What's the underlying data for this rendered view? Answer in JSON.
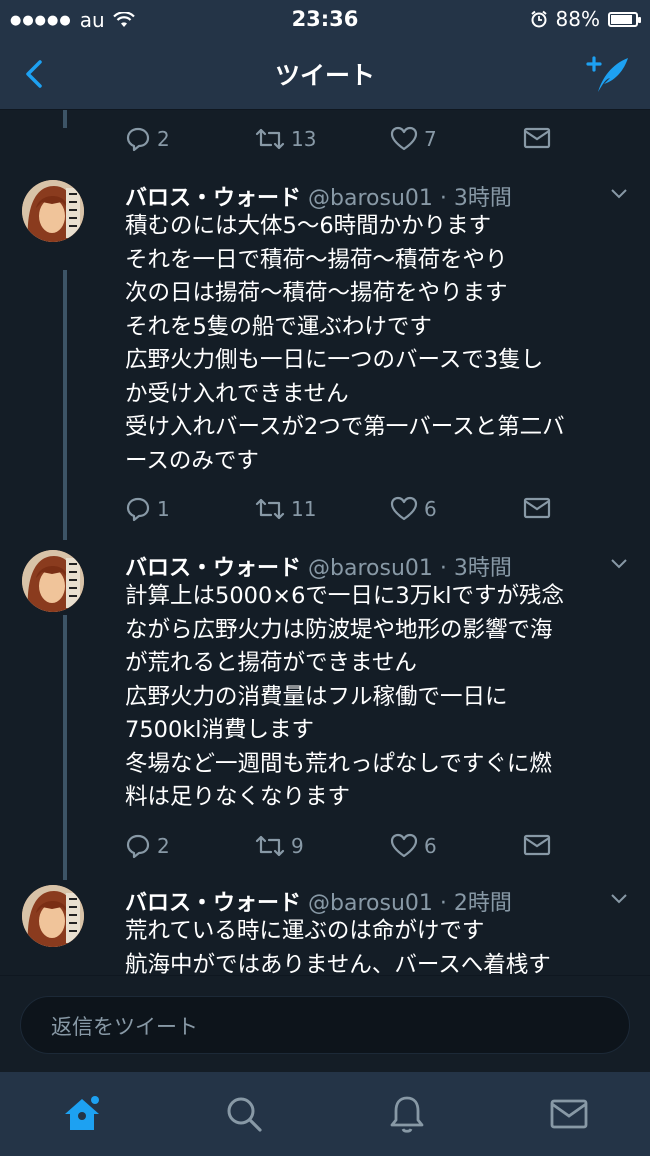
{
  "status": {
    "carrier": "au",
    "time": "23:36",
    "battery": "88%",
    "battery_level": 0.88
  },
  "nav": {
    "title": "ツイート"
  },
  "first_actions": {
    "replies": "2",
    "retweets": "13",
    "likes": "7"
  },
  "tweets": [
    {
      "name": "バロス・ウォード",
      "meta": " @barosu01 · 3時間",
      "lines": [
        "積むのには大体5～6時間かかります",
        "それを一日で積荷～揚荷～積荷をやり",
        "次の日は揚荷～積荷～揚荷をやります",
        "それを5隻の船で運ぶわけです",
        "広野火力側も一日に一つのバースで3隻し",
        "か受け入れできません",
        "受け入れバースが2つで第一バースと第二バ",
        "ースのみです"
      ],
      "replies": "1",
      "retweets": "11",
      "likes": "6"
    },
    {
      "name": "バロス・ウォード",
      "meta": " @barosu01 · 3時間",
      "lines": [
        "計算上は5000×6で一日に3万klですが残念",
        "ながら広野火力は防波堤や地形の影響で海",
        "が荒れると揚荷ができません",
        "広野火力の消費量はフル稼働で一日に",
        "7500kl消費します",
        "冬場など一週間も荒れっぱなしですぐに燃",
        "料は足りなくなります"
      ],
      "replies": "2",
      "retweets": "9",
      "likes": "6"
    },
    {
      "name": "バロス・ウォード",
      "meta": " @barosu01 · 2時間",
      "lines": [
        "荒れている時に運ぶのは命がけです",
        "航海中がではありません、バースへ着桟す"
      ]
    }
  ],
  "reply": {
    "placeholder": "返信をツイート"
  },
  "tabs": [
    "home-icon",
    "search-icon",
    "notifications-icon",
    "messages-icon"
  ],
  "colors": {
    "background": "#141d26",
    "bar": "#243447",
    "accent": "#1da1f2",
    "muted": "#8899a6"
  }
}
